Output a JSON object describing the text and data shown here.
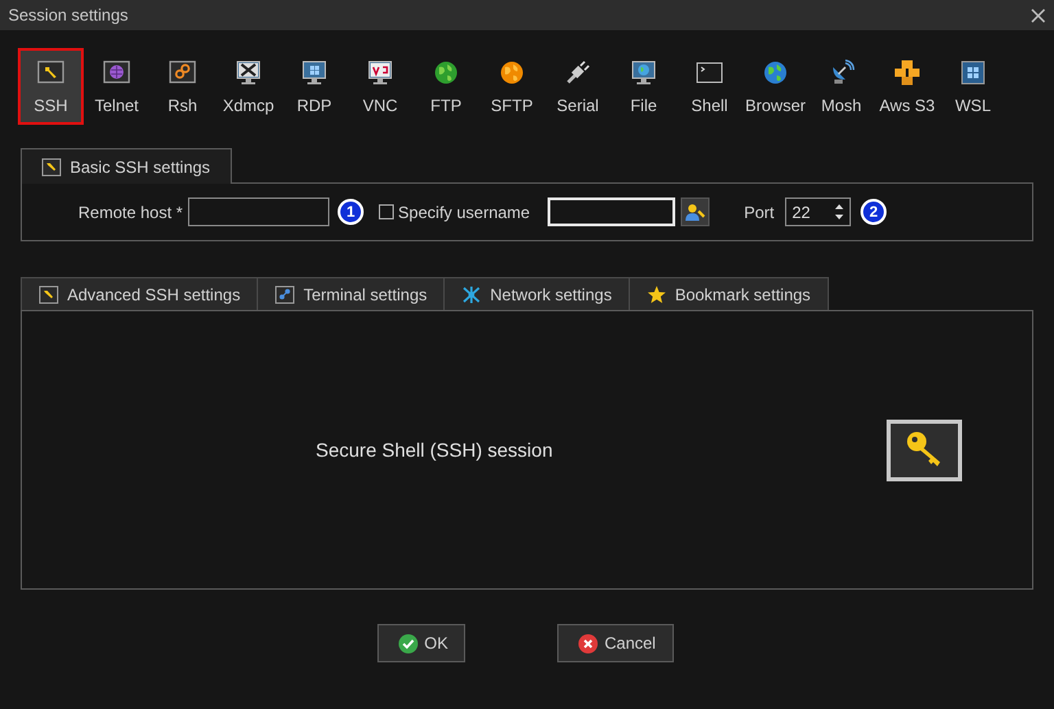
{
  "window": {
    "title": "Session settings"
  },
  "session_types": [
    {
      "label": "SSH",
      "kind": "ssh",
      "selected": true
    },
    {
      "label": "Telnet",
      "kind": "telnet",
      "selected": false
    },
    {
      "label": "Rsh",
      "kind": "rsh",
      "selected": false
    },
    {
      "label": "Xdmcp",
      "kind": "xdmcp",
      "selected": false
    },
    {
      "label": "RDP",
      "kind": "rdp",
      "selected": false
    },
    {
      "label": "VNC",
      "kind": "vnc",
      "selected": false
    },
    {
      "label": "FTP",
      "kind": "ftp",
      "selected": false
    },
    {
      "label": "SFTP",
      "kind": "sftp",
      "selected": false
    },
    {
      "label": "Serial",
      "kind": "serial",
      "selected": false
    },
    {
      "label": "File",
      "kind": "file",
      "selected": false
    },
    {
      "label": "Shell",
      "kind": "shell",
      "selected": false
    },
    {
      "label": "Browser",
      "kind": "browser",
      "selected": false
    },
    {
      "label": "Mosh",
      "kind": "mosh",
      "selected": false
    },
    {
      "label": "Aws S3",
      "kind": "aws",
      "selected": false
    },
    {
      "label": "WSL",
      "kind": "wsl",
      "selected": false
    }
  ],
  "basic_settings": {
    "tab": "Basic SSH settings",
    "remote_host_label": "Remote host *",
    "remote_host_badge": "1",
    "specify_username": {
      "label": "Specify username",
      "checked": false
    },
    "port": {
      "label": "Port",
      "value": "22"
    },
    "port_badge": "2"
  },
  "tabs": [
    {
      "label": "Advanced SSH settings",
      "kind": "wrench"
    },
    {
      "label": "Terminal settings",
      "kind": "terminal"
    },
    {
      "label": "Network settings",
      "kind": "network"
    },
    {
      "label": "Bookmark settings",
      "kind": "star"
    }
  ],
  "panel": {
    "description": "Secure Shell (SSH) session"
  },
  "buttons": [
    {
      "label": "OK",
      "kind": "ok"
    },
    {
      "label": "Cancel",
      "kind": "cancel"
    }
  ]
}
